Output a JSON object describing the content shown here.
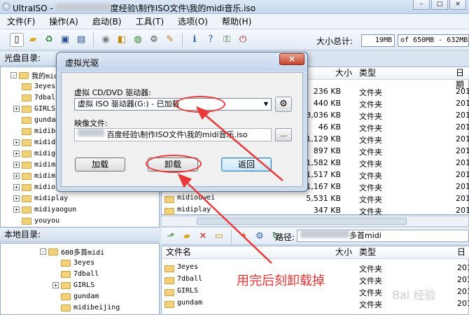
{
  "window": {
    "title_prefix": "UltraISO - ",
    "title_suffix": "度经验\\制作ISO文件\\我的midi音乐.iso",
    "controls": [
      "–",
      "□",
      "×"
    ]
  },
  "menu": [
    "文件(F)",
    "操作(A)",
    "启动(B)",
    "工具(T)",
    "选项(O)",
    "帮助(H)"
  ],
  "toolbar": {
    "icons": [
      "new-icon",
      "open-icon",
      "reload-icon",
      "save-icon",
      "save-as-icon",
      "burn-icon",
      "mount-icon",
      "compress-icon",
      "tools-icon",
      "options-icon",
      "info-icon",
      "help-icon",
      "register-icon",
      "exit-icon"
    ],
    "total_label": "大小总计:",
    "total_value": "19MB",
    "capacity": "of 650MB - 632MB"
  },
  "disc_pane": {
    "title": "光盘目录:",
    "tree": [
      {
        "label": "我的midi",
        "level": 0,
        "expander": "-"
      },
      {
        "label": "3eyes",
        "level": 1,
        "expander": ""
      },
      {
        "label": "7dball",
        "level": 1,
        "expander": ""
      },
      {
        "label": "GIRLS",
        "level": 1,
        "expander": "+"
      },
      {
        "label": "gundam",
        "level": 1,
        "expander": ""
      },
      {
        "label": "midibe",
        "level": 1,
        "expander": ""
      },
      {
        "label": "midido",
        "level": 1,
        "expander": "+"
      },
      {
        "label": "midigo",
        "level": 1,
        "expander": "+"
      },
      {
        "label": "midima",
        "level": 1,
        "expander": "+"
      },
      {
        "label": "midimu",
        "level": 1,
        "expander": "+"
      },
      {
        "label": "midiou",
        "level": 1,
        "expander": "+"
      },
      {
        "label": "midiplay",
        "level": 1,
        "expander": "+"
      },
      {
        "label": "midiyaogun",
        "level": 1,
        "expander": "+"
      },
      {
        "label": "youyou",
        "level": 1,
        "expander": ""
      }
    ],
    "columns": {
      "size": "大小",
      "type": "类型",
      "date": "日期"
    },
    "rows": [
      {
        "name": "",
        "size": "236 KB",
        "type": "文件夹",
        "date": "201"
      },
      {
        "name": "",
        "size": "440 KB",
        "type": "文件夹",
        "date": "201"
      },
      {
        "name": "",
        "size": "3,036 KB",
        "type": "文件夹",
        "date": "201"
      },
      {
        "name": "",
        "size": "46 KB",
        "type": "文件夹",
        "date": "201"
      },
      {
        "name": "",
        "size": "1,129 KB",
        "type": "文件夹",
        "date": "201"
      },
      {
        "name": "",
        "size": "897 KB",
        "type": "文件夹",
        "date": "201"
      },
      {
        "name": "",
        "size": "1,582 KB",
        "type": "文件夹",
        "date": "201"
      },
      {
        "name": "",
        "size": "1,517 KB",
        "type": "文件夹",
        "date": "201"
      },
      {
        "name": "",
        "size": "1,167 KB",
        "type": "文件夹",
        "date": "201"
      },
      {
        "name": "midiouwei",
        "size": "5,531 KB",
        "type": "文件夹",
        "date": "201"
      },
      {
        "name": "midiplay",
        "size": "347 KB",
        "type": "文件夹",
        "date": "201"
      }
    ]
  },
  "local_pane": {
    "title": "本地目录:",
    "tree": [
      {
        "label": "600多首midi",
        "level": 0,
        "expander": "-"
      },
      {
        "label": "3eyes",
        "level": 1,
        "expander": ""
      },
      {
        "label": "7dball",
        "level": 1,
        "expander": ""
      },
      {
        "label": "GIRLS",
        "level": 1,
        "expander": "+"
      },
      {
        "label": "gundam",
        "level": 1,
        "expander": ""
      },
      {
        "label": "midibeijing",
        "level": 1,
        "expander": ""
      }
    ],
    "path_label": "路径:",
    "path_value": "多首midi",
    "columns": {
      "name": "文件名",
      "size": "大小",
      "type": "类型",
      "date": "日"
    },
    "rows": [
      {
        "name": "3eyes",
        "type": "文件夹",
        "date": "201"
      },
      {
        "name": "7dball",
        "type": "文件夹",
        "date": "201"
      },
      {
        "name": "GIRLS",
        "type": "文件夹",
        "date": "201"
      },
      {
        "name": "gundam",
        "type": "文件夹",
        "date": "201"
      }
    ]
  },
  "dialog": {
    "title": "虚拟光驱",
    "close": "×",
    "drive_label": "虚拟 CD/DVD 驱动器:",
    "drive_value": "虚拟 ISO 驱动器(G:) - 已加载",
    "image_label": "映像文件:",
    "image_value": "百度经验\\制作ISO文件\\我的midi音乐.iso",
    "browse": "...",
    "buttons": {
      "load": "加载",
      "unload": "卸载",
      "return": "返回"
    }
  },
  "annotation": {
    "text": "用完后刻卸载掉",
    "color": "#e23636",
    "watermark": "Bai 经验"
  }
}
